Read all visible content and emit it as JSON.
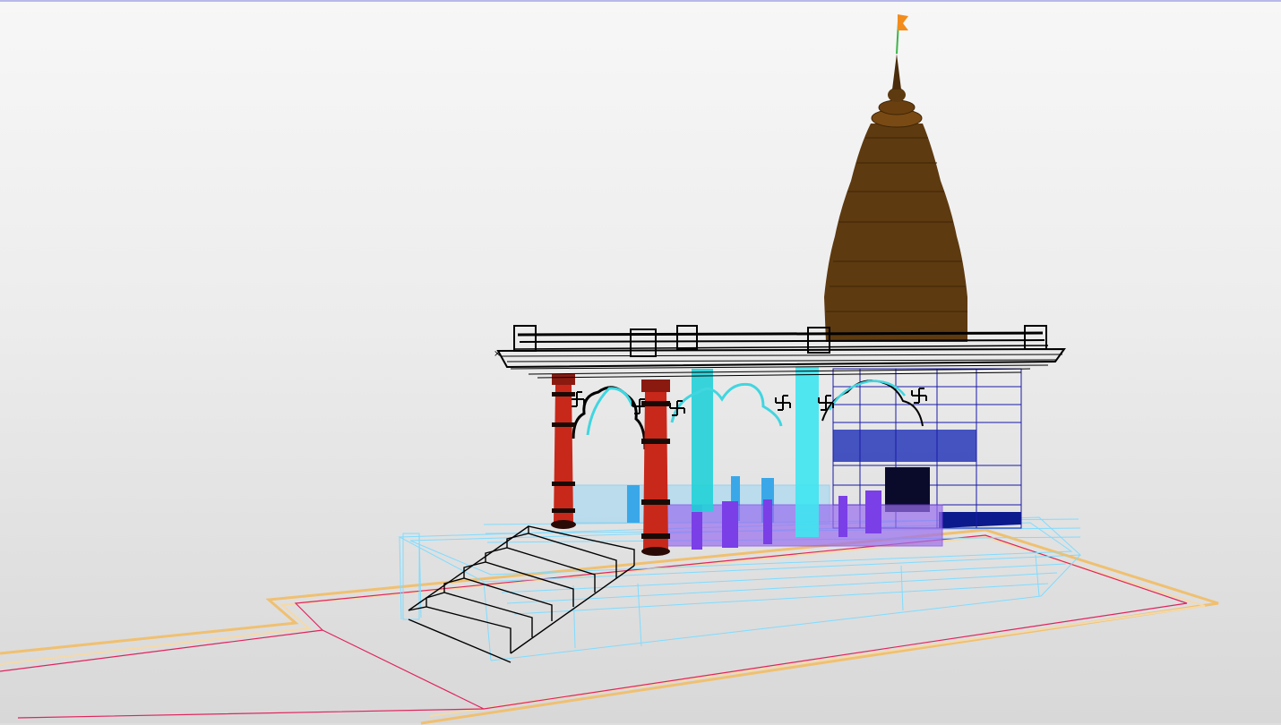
{
  "viewport": {
    "background_top": "#f7f7f7",
    "background_bottom": "#d8d8d8",
    "frame_color": "#b8b8ea"
  },
  "colors": {
    "shikhara": "#5e3a10",
    "shikhara_line": "#3d2406",
    "flag": "#f28c1c",
    "flag_pole": "#3db54a",
    "roof_wire": "#000000",
    "red_pillar": "#c8281a",
    "cyan_pillar": "#22d2d8",
    "cyan_arch": "#40d6e0",
    "railing_light": "#6ec6f0",
    "railing_purple": "#7a3fe6",
    "sanctum_wire": "#1a1aa8",
    "platform_wire": "#7fdcff",
    "stairs_wire": "#000000",
    "boundary_red": "#e0245e",
    "boundary_yellow": "#f0c070"
  },
  "model": {
    "name": "temple-3d-model",
    "components": [
      "flag",
      "shikhara",
      "roof-slab",
      "red-pillar",
      "cyan-pillar",
      "arch",
      "swastika-ornament",
      "railing",
      "sanctum-frame",
      "platform",
      "stairs",
      "boundary-outline"
    ],
    "swastika_count": 6
  }
}
